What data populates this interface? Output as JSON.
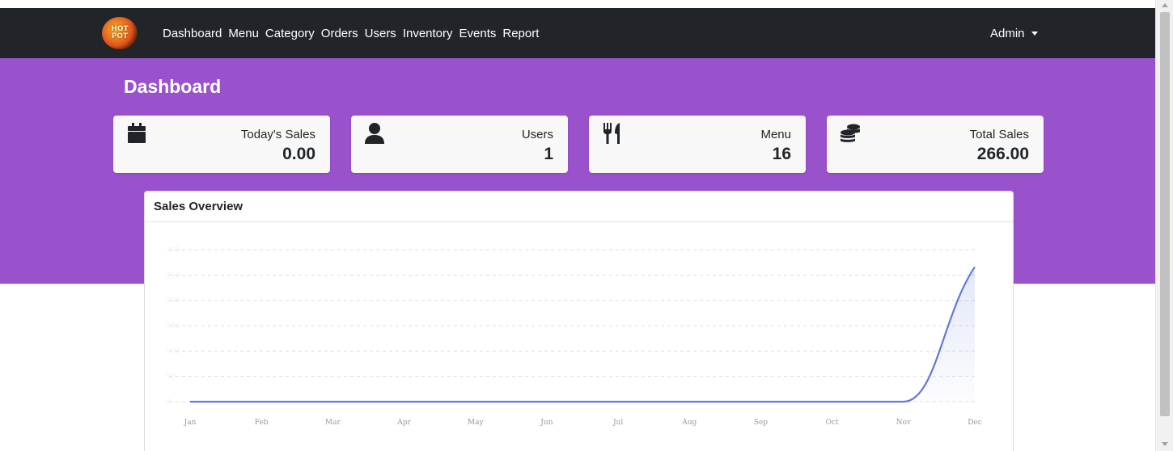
{
  "navbar": {
    "logo_text": "Hot Cooking Pot",
    "links": [
      "Dashboard",
      "Menu",
      "Category",
      "Orders",
      "Users",
      "Inventory",
      "Events",
      "Report"
    ],
    "user_menu": "Admin"
  },
  "page": {
    "title": "Dashboard"
  },
  "stats": [
    {
      "icon": "calendar-icon",
      "label": "Today's Sales",
      "value": "0.00"
    },
    {
      "icon": "user-icon",
      "label": "Users",
      "value": "1"
    },
    {
      "icon": "utensils-icon",
      "label": "Menu",
      "value": "16"
    },
    {
      "icon": "coins-icon",
      "label": "Total Sales",
      "value": "266.00"
    }
  ],
  "colors": {
    "navbar": "#212529",
    "hero": "#9a52cc",
    "line": "#6478d8",
    "fill": "#e8ecfb"
  },
  "chart": {
    "title": "Sales Overview"
  },
  "chart_data": {
    "type": "area",
    "categories": [
      "Jan",
      "Feb",
      "Mar",
      "Apr",
      "May",
      "Jun",
      "Jul",
      "Aug",
      "Sep",
      "Oct",
      "Nov",
      "Dec"
    ],
    "series": [
      {
        "values": [
          0,
          0,
          0,
          0,
          0,
          0,
          0,
          0,
          0,
          0,
          0,
          266
        ]
      }
    ],
    "ylim": [
      0,
      300
    ],
    "y_ticks": [
      0,
      50,
      100,
      150,
      200,
      250,
      300
    ],
    "grid": true,
    "grid_style": "dashed",
    "legend": "none"
  }
}
